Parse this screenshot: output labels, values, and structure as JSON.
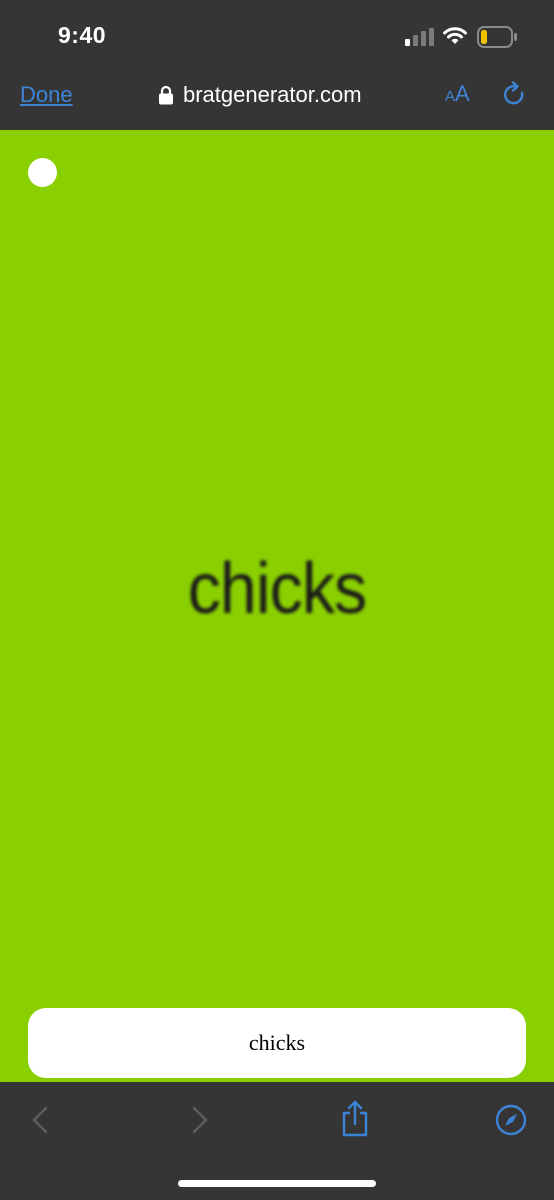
{
  "status_bar": {
    "time": "9:40",
    "battery_color": "#f5c400"
  },
  "browser": {
    "done_label": "Done",
    "url": "bratgenerator.com",
    "text_size_small": "A",
    "text_size_large": "A",
    "accent_color": "#3d84d6"
  },
  "page": {
    "background_color": "#8ad000",
    "display_text": "chicks",
    "input_value": "chicks"
  },
  "toolbar": {
    "icons": [
      "back-icon",
      "forward-icon",
      "share-icon",
      "safari-compass-icon"
    ]
  }
}
